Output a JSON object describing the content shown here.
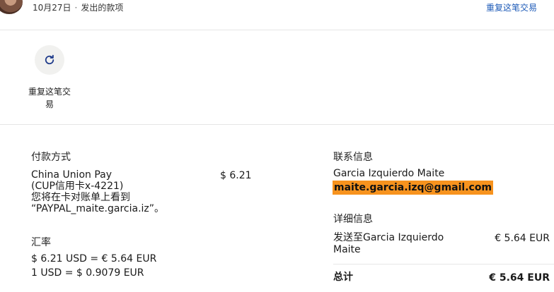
{
  "header": {
    "date": "10月27日",
    "type": "发出的款项",
    "repeat_link": "重复这笔交易"
  },
  "action": {
    "icon": "refresh-icon",
    "label": "重复这笔交易"
  },
  "payment": {
    "title": "付款方式",
    "lines": [
      "China Union Pay",
      "(CUP信用卡x-4221)",
      "您将在卡对账单上看到",
      "“PAYPAL_maite.garcia.iz”。"
    ],
    "amount": "$ 6.21"
  },
  "exchange": {
    "title": "汇率",
    "line1": "$ 6.21 USD = € 5.64 EUR",
    "line2": "1 USD = $ 0.9079 EUR"
  },
  "contact": {
    "title": "联系信息",
    "name": "Garcia Izquierdo Maite",
    "email": "maite.garcia.izq@gmail.com"
  },
  "details": {
    "title": "详细信息",
    "sent_to_line1": "发送至Garcia Izquierdo",
    "sent_to_line2": "Maite",
    "sent_amount": "€ 5.64 EUR",
    "total_label": "总计",
    "total_amount": "€ 5.64 EUR"
  },
  "colors": {
    "link": "#1e5bb8",
    "highlight": "#f7931e"
  }
}
